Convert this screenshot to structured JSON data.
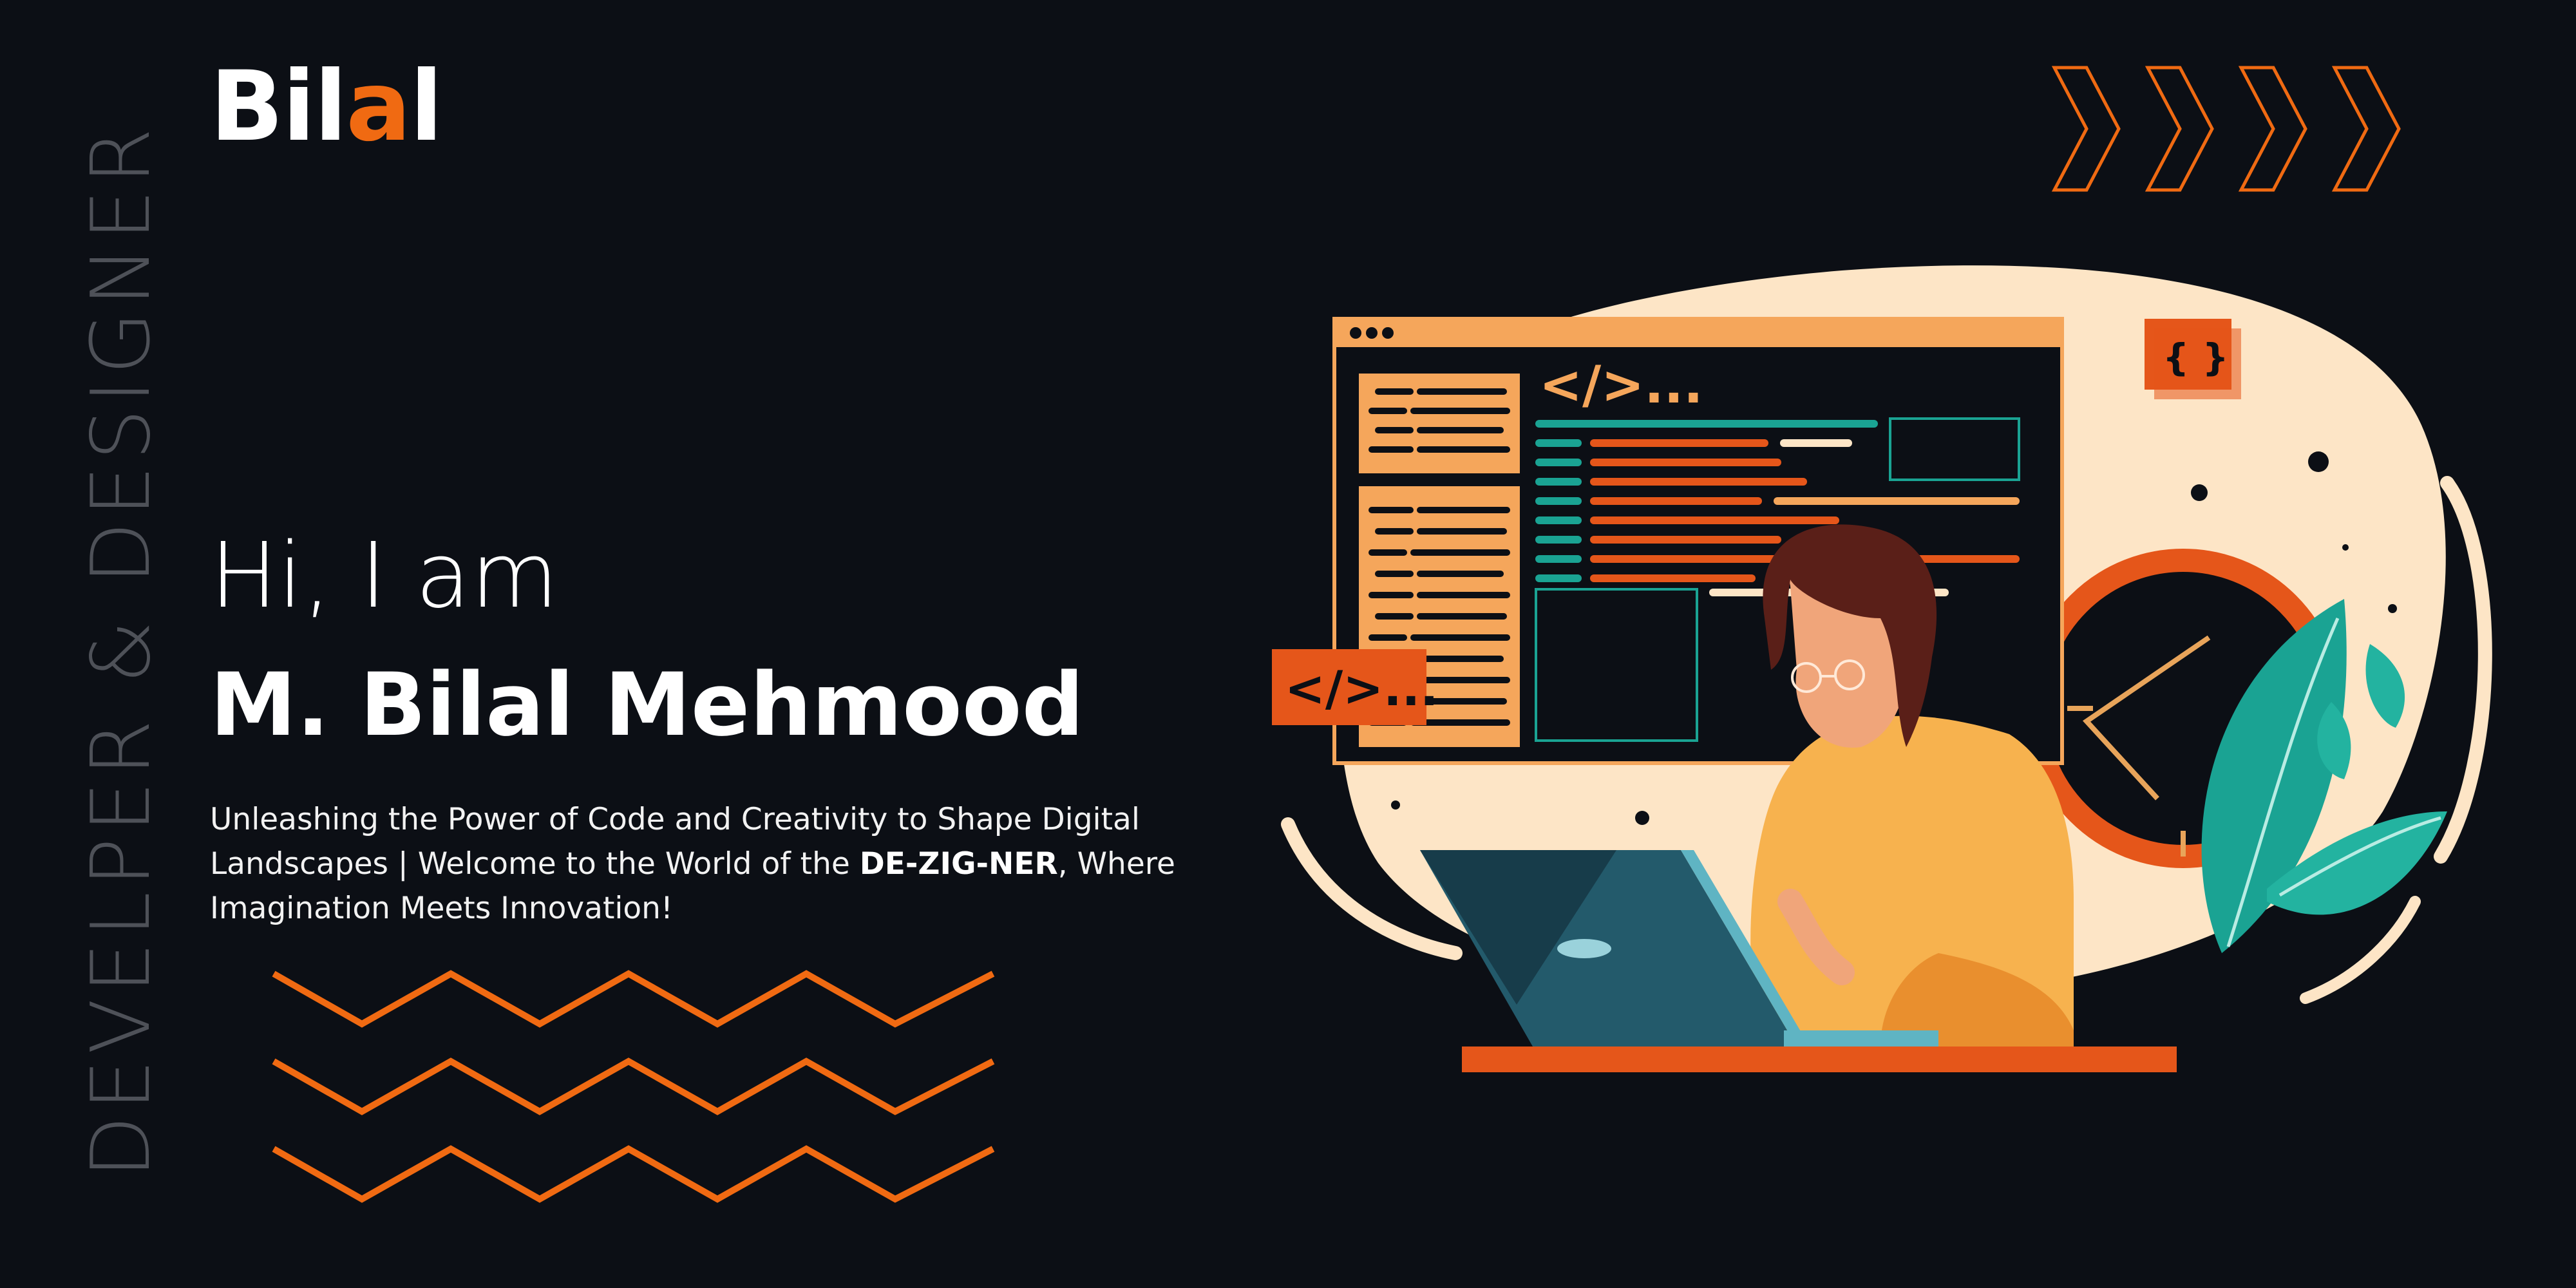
{
  "side_label": "DEVELPER & DESIGNER",
  "logo": {
    "prefix": "Bil",
    "accent": "a",
    "suffix": "l"
  },
  "hero": {
    "greeting": "Hi, I am",
    "name": "M. Bilal Mehmood",
    "tagline_before": "Unleashing the Power of Code and Creativity to Shape Digital Landscapes | Welcome to the World of the ",
    "tagline_bold": "DE-ZIG-NER",
    "tagline_after": ", Where Imagination Meets Innovation!"
  },
  "illustration": {
    "code_tag_large": "</>...",
    "code_tag_small": "</>...",
    "braces_badge": "{ }"
  },
  "colors": {
    "background": "#0c0f15",
    "accent": "#f06a12",
    "cream": "#fde5c6",
    "teal": "#1aa393"
  },
  "icons": [
    "chevron-right-icon",
    "zigzag-decoration",
    "developer-illustration"
  ]
}
